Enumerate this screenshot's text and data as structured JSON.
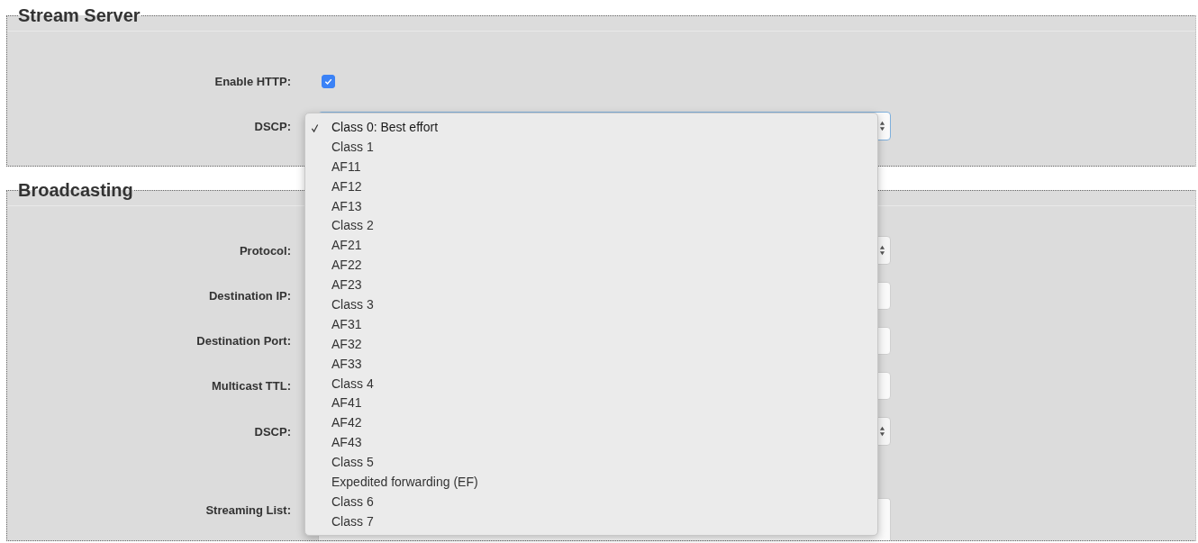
{
  "sections": [
    {
      "title": "Stream Server",
      "fields": [
        {
          "label": "Enable HTTP:",
          "kind": "checkbox",
          "checked": true
        },
        {
          "label": "DSCP:",
          "kind": "select",
          "open": true,
          "options": [
            {
              "label": "Class 0: Best effort",
              "selected": true
            },
            {
              "label": "Class 1",
              "selected": false
            },
            {
              "label": "AF11",
              "selected": false
            },
            {
              "label": "AF12",
              "selected": false
            },
            {
              "label": "AF13",
              "selected": false
            },
            {
              "label": "Class 2",
              "selected": false
            },
            {
              "label": "AF21",
              "selected": false
            },
            {
              "label": "AF22",
              "selected": false
            },
            {
              "label": "AF23",
              "selected": false
            },
            {
              "label": "Class 3",
              "selected": false
            },
            {
              "label": "AF31",
              "selected": false
            },
            {
              "label": "AF32",
              "selected": false
            },
            {
              "label": "AF33",
              "selected": false
            },
            {
              "label": "Class 4",
              "selected": false
            },
            {
              "label": "AF41",
              "selected": false
            },
            {
              "label": "AF42",
              "selected": false
            },
            {
              "label": "AF43",
              "selected": false
            },
            {
              "label": "Class 5",
              "selected": false
            },
            {
              "label": "Expedited forwarding (EF)",
              "selected": false
            },
            {
              "label": "Class 6",
              "selected": false
            },
            {
              "label": "Class 7",
              "selected": false
            }
          ]
        }
      ]
    },
    {
      "title": "Broadcasting",
      "fields": [
        {
          "label": "Protocol:",
          "kind": "select",
          "open": false
        },
        {
          "label": "Destination IP:",
          "kind": "text"
        },
        {
          "label": "Destination Port:",
          "kind": "text"
        },
        {
          "label": "Multicast TTL:",
          "kind": "text"
        },
        {
          "label": "DSCP:",
          "kind": "select",
          "open": false
        },
        {
          "label": "Streaming List:",
          "kind": "textarea"
        }
      ]
    }
  ]
}
